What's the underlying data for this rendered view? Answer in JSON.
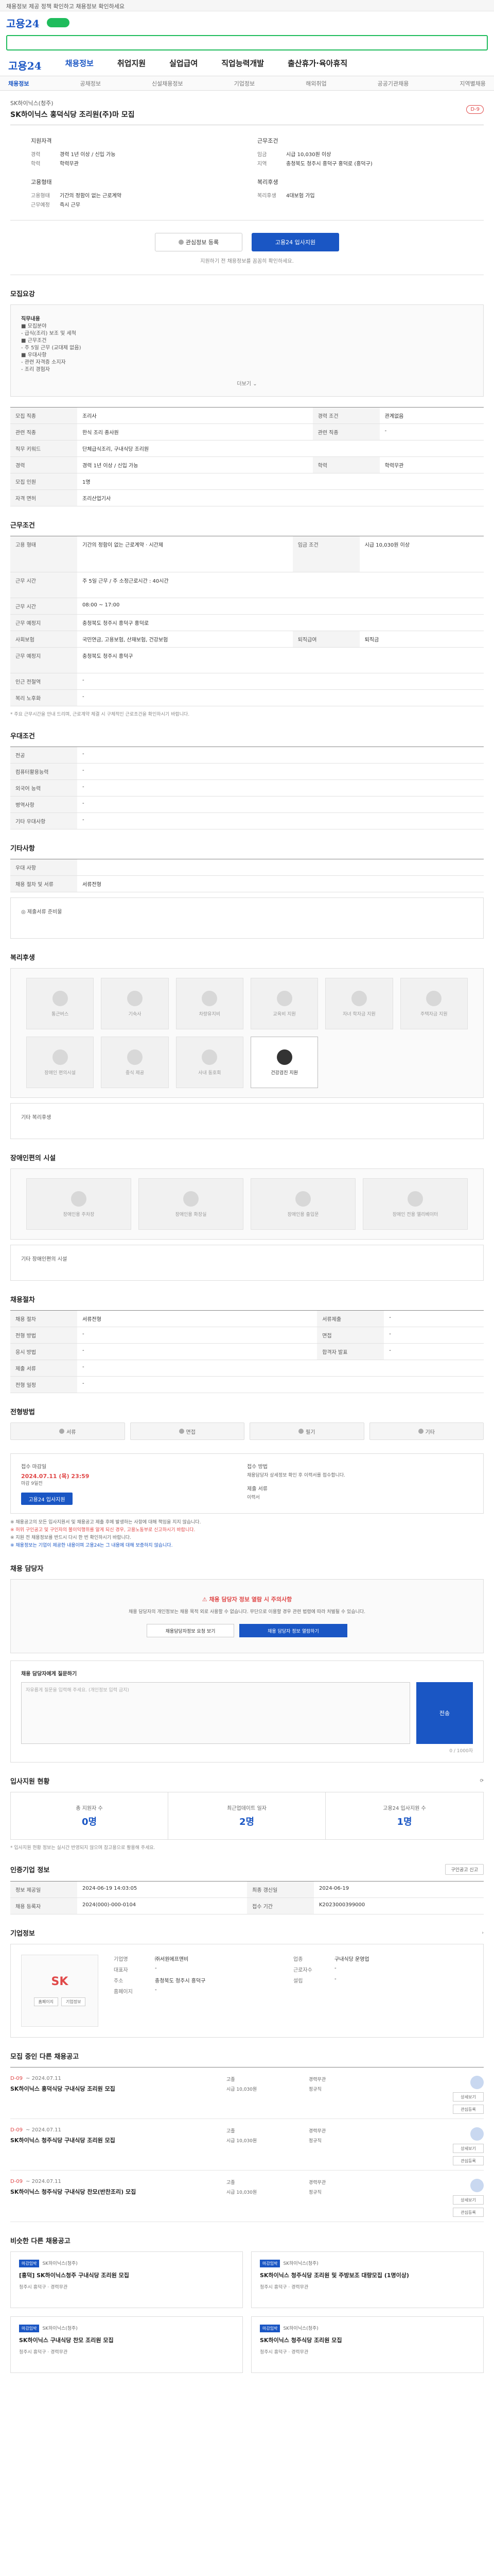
{
  "notice": "채용정보 제공 정책 확인하고 채용정보 확인하세요",
  "logo": "고용24",
  "gnb": [
    "고용24",
    "채용정보",
    "취업지원",
    "실업급여",
    "직업능력개발",
    "출산휴가·육아휴직"
  ],
  "subnav": [
    "채용정보",
    "공채정보",
    "신설채용정보",
    "기업정보",
    "해외취업",
    "공공기관채용",
    "지역별채용"
  ],
  "job": {
    "company": "SK하이닉스(청주)",
    "title": "SK하이닉스 홍덕식당 조리원(주)마 모집",
    "deadline_badge": "D-9"
  },
  "summary": {
    "left_group1": "지원자격",
    "left_rows": [
      [
        "경력",
        "경력 1년 이상 / 신입 가능"
      ],
      [
        "학력",
        "학력무관"
      ]
    ],
    "left_group2": "고용형태",
    "left_rows2": [
      [
        "고용형태",
        "기간의 정함이 없는 근로계약"
      ],
      [
        "근무예정",
        "즉시 근무"
      ]
    ],
    "right_group1": "근무조건",
    "right_rows": [
      [
        "임금",
        "시급 10,030원 이상"
      ],
      [
        "지역",
        "충청북도 청주시 흥덕구 홍덕로 (흥덕구)"
      ]
    ],
    "right_group2": "복리후생",
    "right_rows2": [
      [
        "복리후생",
        "4대보험 가입"
      ]
    ]
  },
  "buttons": {
    "scrap": "관심정보 등록",
    "apply": "고용24 입사지원"
  },
  "btn_tip": "지원하기 전 채용정보를 꼼꼼히 확인하세요.",
  "req": {
    "title": "모집요강",
    "job_content_label": "직무내용",
    "lines": [
      "■ 모집분야",
      "- 급식(조리) 보조 및 세척",
      "■ 근무조건",
      "- 주 5일 근무 (교대제 없음)",
      "■ 우대사항",
      "- 관련 자격증 소지자",
      "- 조리 경험자"
    ],
    "more": "더보기"
  },
  "req_table": [
    [
      "모집 직종",
      "조리사",
      "경력 조건",
      "관계없음"
    ],
    [
      "관련 직종",
      "한식 조리 종사원",
      "관련 직종",
      "-"
    ],
    [
      "직무 키워드",
      "단체급식조리, 구내식당 조리원",
      "",
      ""
    ],
    [
      "경력",
      "경력 1년 이상 / 신입 가능",
      "학력",
      "학력무관"
    ],
    [
      "모집 인원",
      "1명",
      "",
      ""
    ],
    [
      "자격 면허",
      "조리산업기사",
      "",
      ""
    ]
  ],
  "work": {
    "title": "근무조건",
    "rows": [
      [
        "고용 형태",
        "기간의 정함이 없는 근로계약 · 시간제",
        "임금 조건",
        "시급 10,030원 이상"
      ],
      [
        "근무 시간",
        "주 5일 근무 / 주 소정근로시간 : 40시간",
        "",
        ""
      ],
      [
        "근무 시간",
        "08:00 ~ 17:00",
        "",
        ""
      ],
      [
        "근무 예정지",
        "충청북도 청주시 흥덕구 홍덕로",
        "",
        ""
      ],
      [
        "사회보험",
        "국민연금, 고용보험, 산재보험, 건강보험",
        "퇴직급여",
        "퇴직금"
      ],
      [
        "근무 예정지",
        "충청북도 청주시 흥덕구",
        "",
        ""
      ],
      [
        "인근 전철역",
        "-",
        "",
        ""
      ],
      [
        "복리 노후화",
        "-",
        "",
        ""
      ]
    ],
    "note": "* 주요 근무시간을 안내 드리며, 근로계약 체결 시 구체적인 근로조건을 확인하시기 바랍니다."
  },
  "prefs": {
    "title": "우대조건",
    "rows": [
      [
        "전공",
        "-"
      ],
      [
        "컴퓨터활용능력",
        "-"
      ],
      [
        "외국어 능력",
        "-"
      ],
      [
        "병역사항",
        "-"
      ],
      [
        "기타 우대사항",
        "-"
      ]
    ]
  },
  "etc": {
    "title": "기타사항",
    "rows": [
      [
        "우대 사항",
        ""
      ],
      [
        "채용 절차 및 서류",
        "서류전형"
      ]
    ],
    "apply_label": "◎ 제출서류 준비물"
  },
  "welfare": {
    "title": "복리후생",
    "tiles": [
      "통근버스",
      "기숙사",
      "차량유지비",
      "교육비 지원",
      "자녀 학자금 지원",
      "주택자금 지원",
      "장애인 편의시설",
      "중식 제공",
      "사내 동호회",
      "건강검진 지원"
    ],
    "active": "건강검진 지원",
    "extra_label": "기타 복리후생"
  },
  "disability": {
    "title": "장애인편의 시설",
    "tiles": [
      "장애인용 주차장",
      "장애인용 화장실",
      "장애인용 출입문",
      "장애인 전용 엘리베이터"
    ],
    "extra_label": "기타 장애인편의 시설"
  },
  "recruit": {
    "title": "채용절차",
    "rows": [
      [
        "채용 절차",
        "서류전형"
      ],
      [
        "전형 방법",
        "-"
      ],
      [
        "응시 방법",
        "-"
      ],
      [
        "제출 서류",
        "-"
      ],
      [
        "전형 일정",
        "-"
      ]
    ],
    "rows_right": [
      [
        "서류제출",
        "-"
      ],
      [
        "면접",
        "-"
      ],
      [
        "합격자 발표",
        "-"
      ]
    ]
  },
  "channel": {
    "title": "전형방법",
    "items": [
      "서류",
      "면접",
      "필기",
      "기타"
    ]
  },
  "apply": {
    "deadline_label": "접수 마감일",
    "deadline": "2024.07.11 (목) 23:59",
    "remain": "마감 9일전",
    "method_label": "접수 방법",
    "method": "채용담당자 상세정보 확인 후 이력서를 접수합니다.",
    "doc_label": "제출 서류",
    "doc": "이력서",
    "btn": "고용24 입사지원",
    "notes": [
      "※ 채용공고의 모든 입사지원서 및 채용공고 제출 후에 발생하는 사항에 대해 책임을 지지 않습니다.",
      "※ 허위 구인공고 및 구인자의 불이익행위를 알게 되신 경우, 고용노동부로 신고하시기 바랍니다.",
      "※ 지원 전 채용정보를 반드시 다시 한 번 확인하시기 바랍니다.",
      "※ 채용정보는 기업이 제공한 내용이며 고용24는 그 내용에 대해 보증하지 않습니다."
    ]
  },
  "manager": {
    "title": "채용 담당자",
    "alert": "채용 담당자 정보 열람 시 주의사항",
    "desc": "채용 담당자의 개인정보는 채용 목적 외로 사용할 수 없습니다. 무단으로 이용할 경우 관련 법령에 따라 처벌될 수 있습니다.",
    "btn1": "채용담당자정보 요청 보기",
    "btn2": "채용 담당자 정보 열람하기",
    "qa_title": "채용 담당자에게 질문하기",
    "qa_placeholder": "자유롭게 질문을 입력해 주세요. (개인정보 입력 금지)",
    "qa_submit": "전송",
    "qa_count": "0 / 1000자"
  },
  "status": {
    "title": "입사지원 현황",
    "items": [
      [
        "총 지원자 수",
        "0명"
      ],
      [
        "최근업데이트 일자",
        "2명"
      ],
      [
        "고용24 입사지원 수",
        "1명"
      ]
    ],
    "note": "* 입사지원 현황 정보는 실시간 반영되지 않으며 참고용으로 활용해 주세요."
  },
  "posting": {
    "title": "인증기업 정보",
    "rows": [
      [
        "정보 제공일",
        "2024-06-19 14:03:05",
        "최종 갱신일",
        "2024-06-19"
      ],
      [
        "채용 등록자",
        "2024(000)-000-0104",
        "접수 기간",
        "K2023000399000"
      ]
    ],
    "btn": "구인공고 신고"
  },
  "company_info": {
    "title": "기업정보",
    "logo_name": "SK",
    "mini_btns": [
      "홈페이지",
      "기업정보"
    ],
    "rows": [
      [
        "기업명",
        "㈜서원에프앤비",
        "업종",
        "구내식당 운영업"
      ],
      [
        "대표자",
        "-",
        "근로자수",
        "-"
      ],
      [
        "주소",
        "충청북도 청주시 흥덕구",
        "설립",
        "-"
      ],
      [
        "홈페이지",
        "-",
        "",
        ""
      ]
    ]
  },
  "related": {
    "title": "모집 중인 다른 채용공고",
    "items": [
      {
        "dday": "D-09",
        "date": "~ 2024.07.11",
        "title": "SK하이닉스 흥덕식당 구내식당 조리원 모집",
        "info": [
          "고졸",
          "경력무관",
          "시급 10,030원",
          "정규직"
        ]
      },
      {
        "dday": "D-09",
        "date": "~ 2024.07.11",
        "title": "SK하이닉스 청주식당 구내식당 조리원 모집",
        "info": [
          "고졸",
          "경력무관",
          "시급 10,030원",
          "정규직"
        ]
      },
      {
        "dday": "D-09",
        "date": "~ 2024.07.11",
        "title": "SK하이닉스 청주식당 구내식당 찬모(반찬조리) 모집",
        "info": [
          "고졸",
          "경력무관",
          "시급 10,030원",
          "정규직"
        ]
      }
    ],
    "btn_detail": "상세보기",
    "btn_scrap": "관심등록"
  },
  "similar": {
    "title": "비슷한 다른 채용공고",
    "cards": [
      {
        "tag": "마감임박",
        "company": "SK하이닉스(청주)",
        "title": "[흥덕] SK하이닉스청주 구내식당 조리원 모집",
        "info": "청주시 흥덕구 · 경력무관"
      },
      {
        "tag": "마감임박",
        "company": "SK하이닉스(청주)",
        "title": "SK하이닉스 청주식당 조리원 및 주방보조 대량모집 (1명이상)",
        "info": "청주시 흥덕구 · 경력무관"
      },
      {
        "tag": "마감임박",
        "company": "SK하이닉스(청주)",
        "title": "SK하이닉스 구내식당 찬모 조리원 모집",
        "info": "청주시 흥덕구 · 경력무관"
      },
      {
        "tag": "마감임박",
        "company": "SK하이닉스(청주)",
        "title": "SK하이닉스 청주식당 조리원 모집",
        "info": "청주시 흥덕구 · 경력무관"
      }
    ]
  }
}
